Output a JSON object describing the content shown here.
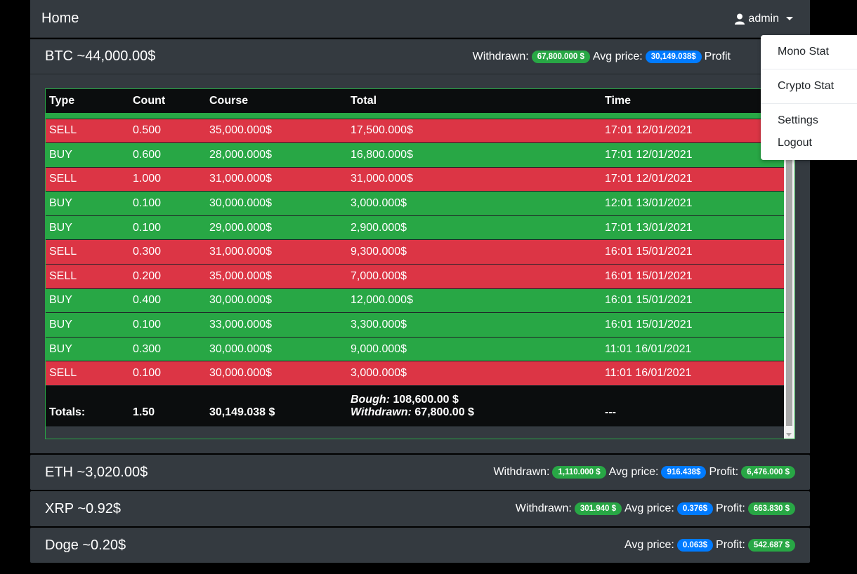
{
  "navbar": {
    "brand": "Home",
    "user": "admin"
  },
  "btc": {
    "title": "BTC ~44,000.00$",
    "withdrawn_label": "Withdrawn:",
    "withdrawn": "67,800.000 $",
    "avg_label": "Avg price:",
    "avg": "30,149.038$",
    "profit_label": "Profit"
  },
  "table": {
    "headers": [
      "Type",
      "Count",
      "Course",
      "Total",
      "Time"
    ],
    "rows": [
      {
        "type": "SELL",
        "count": "0.500",
        "course": "35,000.000$",
        "total": "17,500.000$",
        "time": "17:01 12/01/2021"
      },
      {
        "type": "BUY",
        "count": "0.600",
        "course": "28,000.000$",
        "total": "16,800.000$",
        "time": "17:01 12/01/2021"
      },
      {
        "type": "SELL",
        "count": "1.000",
        "course": "31,000.000$",
        "total": "31,000.000$",
        "time": "17:01 12/01/2021"
      },
      {
        "type": "BUY",
        "count": "0.100",
        "course": "30,000.000$",
        "total": "3,000.000$",
        "time": "12:01 13/01/2021"
      },
      {
        "type": "BUY",
        "count": "0.100",
        "course": "29,000.000$",
        "total": "2,900.000$",
        "time": "17:01 13/01/2021"
      },
      {
        "type": "SELL",
        "count": "0.300",
        "course": "31,000.000$",
        "total": "9,300.000$",
        "time": "16:01 15/01/2021"
      },
      {
        "type": "SELL",
        "count": "0.200",
        "course": "35,000.000$",
        "total": "7,000.000$",
        "time": "16:01 15/01/2021"
      },
      {
        "type": "BUY",
        "count": "0.400",
        "course": "30,000.000$",
        "total": "12,000.000$",
        "time": "16:01 15/01/2021"
      },
      {
        "type": "BUY",
        "count": "0.100",
        "course": "33,000.000$",
        "total": "3,300.000$",
        "time": "16:01 15/01/2021"
      },
      {
        "type": "BUY",
        "count": "0.300",
        "course": "30,000.000$",
        "total": "9,000.000$",
        "time": "11:01 16/01/2021"
      },
      {
        "type": "SELL",
        "count": "0.100",
        "course": "30,000.000$",
        "total": "3,000.000$",
        "time": "11:01 16/01/2021"
      }
    ],
    "totals": {
      "label": "Totals:",
      "count": "1.50",
      "course": "30,149.038 $",
      "bought_label": "Bough:",
      "bought": "108,600.00 $",
      "withdrawn_label": "Withdrawn:",
      "withdrawn": "67,800.00 $",
      "time": "---"
    }
  },
  "coins": [
    {
      "title": "ETH ~3,020.00$",
      "withdrawn_label": "Withdrawn:",
      "withdrawn": "1,110.000 $",
      "avg_label": "Avg price:",
      "avg": "916.438$",
      "profit_label": "Profit:",
      "profit": "6,476.000 $"
    },
    {
      "title": "XRP ~0.92$",
      "withdrawn_label": "Withdrawn:",
      "withdrawn": "301.940 $",
      "avg_label": "Avg price:",
      "avg": "0.376$",
      "profit_label": "Profit:",
      "profit": "663.830 $"
    },
    {
      "title": "Doge ~0.20$",
      "avg_label": "Avg price:",
      "avg": "0.063$",
      "profit_label": "Profit:",
      "profit": "542.687 $"
    }
  ],
  "dropdown": {
    "items": [
      "Mono Stat",
      "Crypto Stat",
      "Settings",
      "Logout"
    ]
  },
  "colors": {
    "buy": "#28a745",
    "sell": "#dc3545",
    "badge_blue": "#007bff",
    "panel": "#343a40"
  }
}
